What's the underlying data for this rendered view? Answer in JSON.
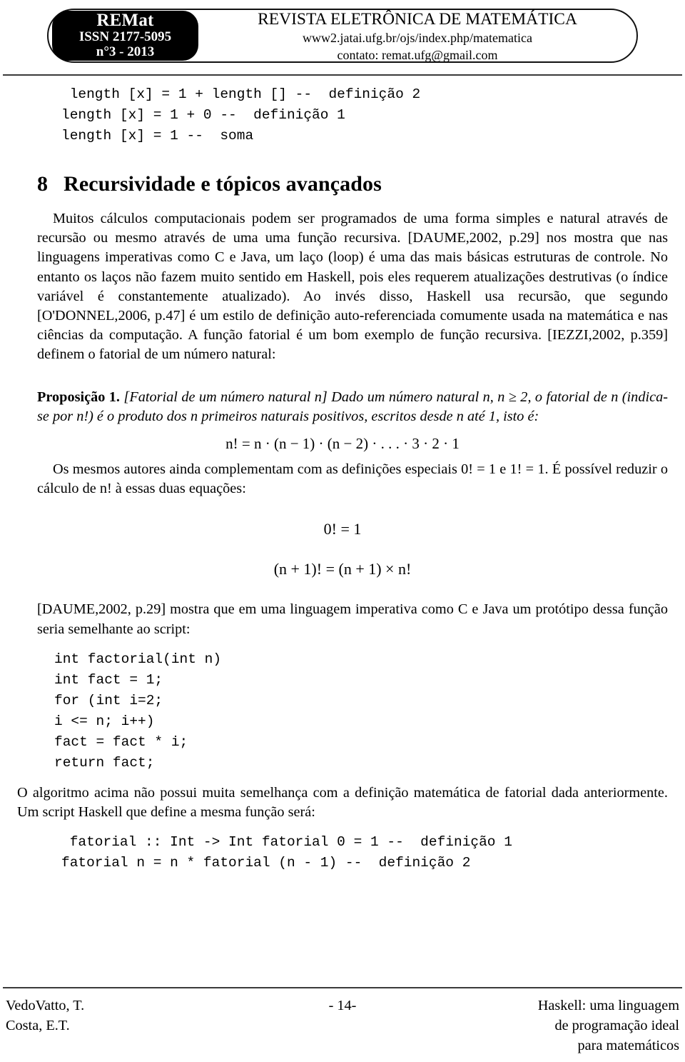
{
  "header": {
    "logo": {
      "title": "REMat",
      "issn": "ISSN 2177-5095",
      "issue": "n°3 - 2013"
    },
    "journal_title": "REVISTA ELETRÔNICA DE MATEMÁTICA",
    "url": "www2.jatai.ufg.br/ojs/index.php/matematica",
    "contact": "contato: remat.ufg@gmail.com"
  },
  "top_code": {
    "lines": [
      " length [x] = 1 + length [] --  definição 2",
      "length [x] = 1 + 0 --  definição 1",
      "length [x] = 1 --  soma"
    ]
  },
  "section": {
    "number": "8",
    "title": "Recursividade e tópicos avançados"
  },
  "paragraphs": {
    "p1": "Muitos cálculos computacionais podem ser programados de uma forma simples e natural através de recursão ou mesmo através de uma uma função recursiva. [DAUME,2002, p.29] nos mostra que nas linguagens imperativas como C e Java, um laço (loop) é uma das mais básicas estruturas de controle. No entanto os laços não fazem muito sentido em Haskell, pois eles requerem atualizações destrutivas (o índice variável é constantemente atualizado). Ao invés disso, Haskell usa recursão, que segundo [O'DONNEL,2006, p.47] é um estilo de definição auto-referenciada comumente usada na matemática e nas ciências da computação. A função fatorial é um bom exemplo de função recursiva. [IEZZI,2002, p.359] definem o fatorial de um número natural:",
    "p2": "Os mesmos autores ainda complementam com as definições especiais 0! = 1 e 1! = 1. É possível reduzir o cálculo de n! à essas duas equações:",
    "p3": "[DAUME,2002, p.29] mostra que em uma linguagem imperativa como C e Java um protótipo dessa função seria semelhante ao script:",
    "p4": "O algoritmo acima não possui muita semelhança com a definição matemática de fatorial dada anteriormente. Um script Haskell que define a mesma função será:"
  },
  "proposition": {
    "label": "Proposição 1.",
    "text": "[Fatorial de um número natural n] Dado um número natural n, n ≥ 2, o fatorial de n (indica-se por n!) é o produto dos n primeiros naturais positivos, escritos desde n até 1, isto é:"
  },
  "equations": {
    "factorial_expansion": "n! = n · (n − 1) · (n − 2) · . . . · 3 · 2 · 1",
    "zero_factorial": "0! = 1",
    "recurrence": "(n + 1)! = (n + 1) × n!"
  },
  "c_code": {
    "lines": [
      "int factorial(int n)",
      "int fact = 1;",
      "for (int i=2;",
      "i <= n; i++)",
      "fact = fact * i;",
      "return fact;"
    ]
  },
  "haskell_code": {
    "lines": [
      " fatorial :: Int -> Int fatorial 0 = 1 --  definição 1",
      "fatorial n = n * fatorial (n - 1) --  definição 2"
    ]
  },
  "footer": {
    "authors": [
      "VedoVatto, T.",
      "Costa, E.T."
    ],
    "page_number": "- 14-",
    "article_title": [
      "Haskell: uma linguagem",
      "de programação ideal",
      "para matemáticos"
    ]
  }
}
